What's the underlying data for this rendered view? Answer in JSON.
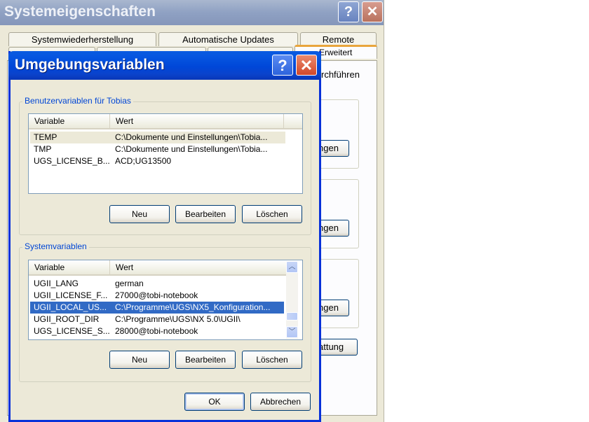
{
  "background_window": {
    "title": "Systemeigenschaften",
    "help_glyph": "?",
    "close_glyph": "✕",
    "tabs_row1": [
      "Systemwiederherstellung",
      "Automatische Updates",
      "Remote"
    ],
    "active_tab": "Erweitert",
    "partial_texts": {
      "line1": "rchführen",
      "btn1": "ngen",
      "btn2": "ngen",
      "btn3": "ngen",
      "btn4": "attung"
    }
  },
  "dialog": {
    "title": "Umgebungsvariablen",
    "help_glyph": "?",
    "close_glyph": "✕",
    "user_group": {
      "label": "Benutzervariablen für Tobias",
      "columns": [
        "Variable",
        "Wert"
      ],
      "rows": [
        {
          "variable": "TEMP",
          "value": "C:\\Dokumente und Einstellungen\\Tobia..."
        },
        {
          "variable": "TMP",
          "value": "C:\\Dokumente und Einstellungen\\Tobia..."
        },
        {
          "variable": "UGS_LICENSE_B...",
          "value": "ACD;UG13500"
        }
      ],
      "buttons": {
        "new": "Neu",
        "edit": "Bearbeiten",
        "delete": "Löschen"
      }
    },
    "system_group": {
      "label": "Systemvariablen",
      "columns": [
        "Variable",
        "Wert"
      ],
      "rows": [
        {
          "variable": "UGII_LANG",
          "value": "german"
        },
        {
          "variable": "UGII_LICENSE_F...",
          "value": "27000@tobi-notebook"
        },
        {
          "variable": "UGII_LOCAL_US...",
          "value": "C:\\Programme\\UGS\\NX5_Konfiguration..."
        },
        {
          "variable": "UGII_ROOT_DIR",
          "value": "C:\\Programme\\UGS\\NX 5.0\\UGII\\"
        },
        {
          "variable": "UGS_LICENSE_S...",
          "value": "28000@tobi-notebook"
        }
      ],
      "buttons": {
        "new": "Neu",
        "edit": "Bearbeiten",
        "delete": "Löschen"
      },
      "scroll": {
        "up_icon": "scroll-up-arrow",
        "down_icon": "scroll-down-arrow",
        "up_glyph": "︿",
        "down_glyph": "﹀"
      }
    },
    "ok_label": "OK",
    "cancel_label": "Abbrechen"
  },
  "colors": {
    "dialog_title": "#0047d8",
    "selection": "#316ac5",
    "group_label": "#0046d5",
    "tab_highlight": "#e9a53c"
  }
}
